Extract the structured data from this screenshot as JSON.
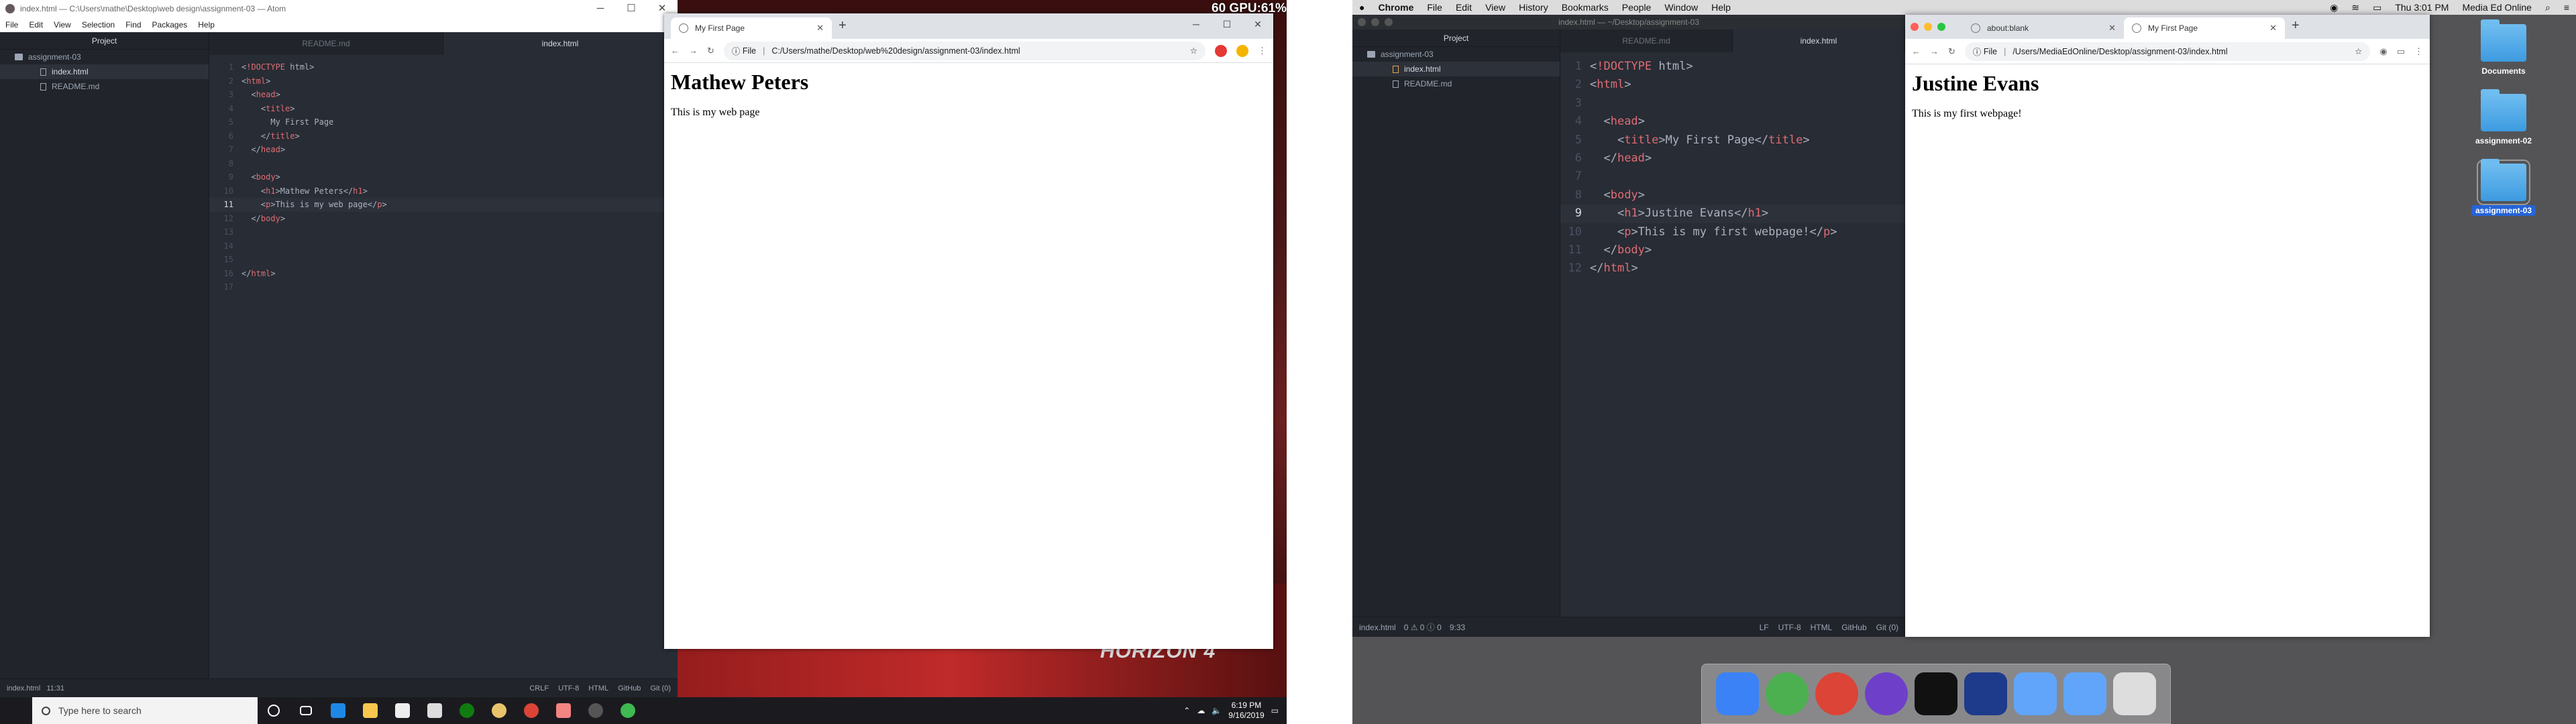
{
  "left": {
    "fps": "60 GPU:61%",
    "wallpaper_text": "HORIZON 4",
    "atom": {
      "title": "index.html — C:\\Users\\mathe\\Desktop\\web design\\assignment-03 — Atom",
      "menu": [
        "File",
        "Edit",
        "View",
        "Selection",
        "Find",
        "Packages",
        "Help"
      ],
      "tree_title": "Project",
      "tree": [
        "assignment-03",
        "index.html",
        "README.md"
      ],
      "tabs": [
        "README.md",
        "index.html"
      ],
      "code": [
        "<!DOCTYPE html>",
        "<html>",
        "  <head>",
        "    <title>",
        "      My First Page",
        "    </title>",
        "  </head>",
        "",
        "  <body>",
        "    <h1>Mathew Peters</h1>",
        "    <p>This is my web page</p>",
        "  </body>",
        "",
        "",
        "",
        "</html>",
        ""
      ],
      "line_numbers": [
        "1",
        "2",
        "3",
        "4",
        "5",
        "6",
        "7",
        "8",
        "9",
        "10",
        "11",
        "12",
        "13",
        "14",
        "15",
        "16",
        "17"
      ],
      "status_left": [
        "index.html",
        "11:31"
      ],
      "status_right": [
        "CRLF",
        "UTF-8",
        "HTML",
        "GitHub",
        "Git (0)"
      ]
    },
    "chrome": {
      "tab_title": "My First Page",
      "address_scheme": "File",
      "address": "C:/Users/mathe/Desktop/web%20design/assignment-03/index.html",
      "heading": "Mathew Peters",
      "paragraph": "This is my web page"
    },
    "taskbar": {
      "search_placeholder": "Type here to search",
      "time": "6:19 PM",
      "date": "9/16/2019"
    }
  },
  "right": {
    "menubar": {
      "app": "Chrome",
      "items": [
        "File",
        "Edit",
        "View",
        "History",
        "Bookmarks",
        "People",
        "Window",
        "Help"
      ],
      "clock": "Thu 3:01 PM",
      "user": "Media Ed Online"
    },
    "atom": {
      "title": "index.html — ~/Desktop/assignment-03",
      "tree_title": "Project",
      "tree": [
        "assignment-03",
        "index.html",
        "README.md"
      ],
      "tabs": [
        "README.md",
        "index.html"
      ],
      "code": [
        "<!DOCTYPE html>",
        "<html>",
        "",
        "  <head>",
        "    <title>My First Page</title>",
        "  </head>",
        "",
        "  <body>",
        "    <h1>Justine Evans</h1>",
        "    <p>This is my first webpage!</p>",
        "  </body>",
        "</html>"
      ],
      "line_numbers": [
        "1",
        "2",
        "3",
        "4",
        "5",
        "6",
        "7",
        "8",
        "9",
        "10",
        "11",
        "12"
      ],
      "status_left": [
        "index.html",
        "0 ⚠ 0 ⓘ 0",
        "9:33"
      ],
      "status_right": [
        "LF",
        "UTF-8",
        "HTML",
        "GitHub",
        "Git (0)"
      ]
    },
    "chrome": {
      "tabs": [
        "about:blank",
        "My First Page"
      ],
      "address_scheme": "File",
      "address": "/Users/MediaEdOnline/Desktop/assignment-03/index.html",
      "heading": "Justine Evans",
      "paragraph": "This is my first webpage!"
    },
    "desktop_icons": [
      "Documents",
      "assignment-02",
      "assignment-03"
    ]
  }
}
